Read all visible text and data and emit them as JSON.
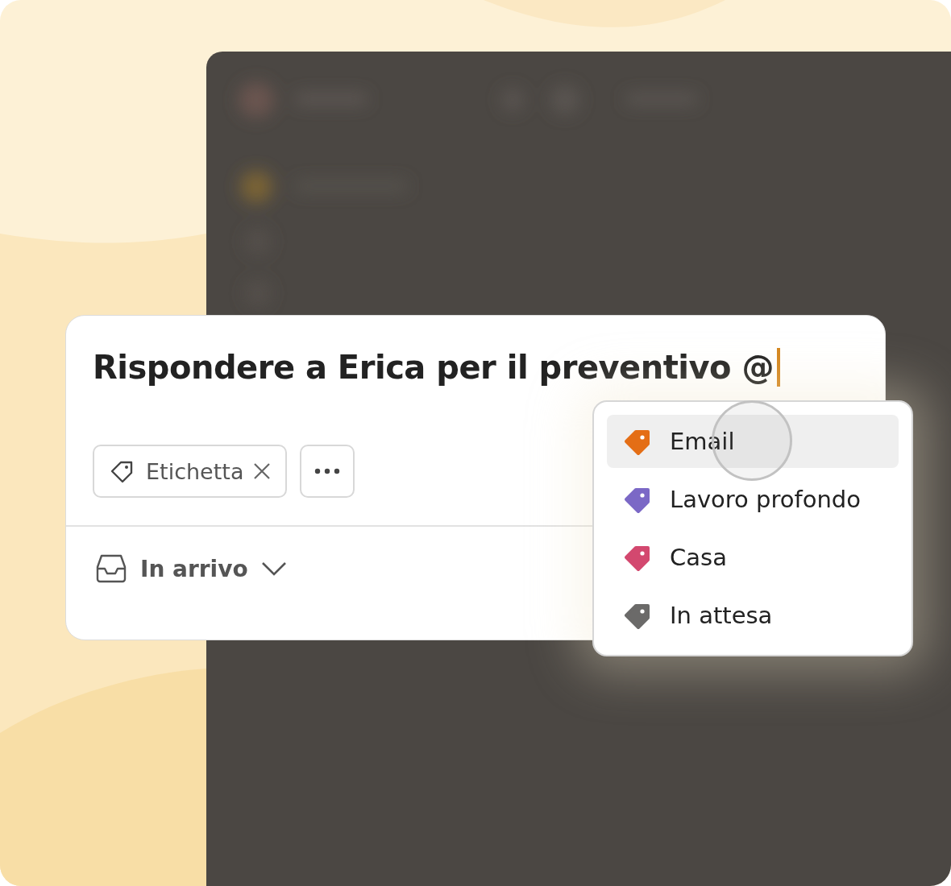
{
  "task": {
    "title": "Rispondere a Erica per il preventivo @",
    "label_chip": {
      "text": "Etichetta"
    },
    "project": "In arrivo"
  },
  "menu": {
    "items": [
      {
        "label": "Email",
        "color": "#e46e16",
        "selected": true
      },
      {
        "label": "Lavoro profondo",
        "color": "#7b68c6",
        "selected": false
      },
      {
        "label": "Casa",
        "color": "#d3486f",
        "selected": false
      },
      {
        "label": "In attesa",
        "color": "#6b6a69",
        "selected": false
      }
    ]
  }
}
